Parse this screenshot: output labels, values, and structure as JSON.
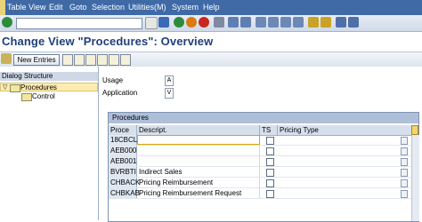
{
  "menu": [
    "Table View",
    "Edit",
    "Goto",
    "Selection",
    "Utilities(M)",
    "System",
    "Help"
  ],
  "page_title": "Change View \"Procedures\": Overview",
  "toolbar": {
    "new_entries": "New Entries"
  },
  "left_panel": {
    "header": "Dialog Structure",
    "nodes": [
      "Procedures",
      "Control"
    ]
  },
  "fields": {
    "usage_label": "Usage",
    "usage_value": "A",
    "application_label": "Application",
    "application_value": "V"
  },
  "procedures": {
    "title": "Procedures",
    "columns": [
      "Proce",
      "Descript.",
      "TS",
      "Pricing Type"
    ],
    "rows": [
      {
        "proc": "18CBCL",
        "desc": ""
      },
      {
        "proc": "AEB000",
        "desc": ""
      },
      {
        "proc": "AEB001",
        "desc": ""
      },
      {
        "proc": "BVRBTI",
        "desc": "Indirect Sales"
      },
      {
        "proc": "CHBACK",
        "desc": "Pricing Reimbursement"
      },
      {
        "proc": "CHBKAB",
        "desc": "Pricing Reimbursement Request"
      }
    ]
  }
}
